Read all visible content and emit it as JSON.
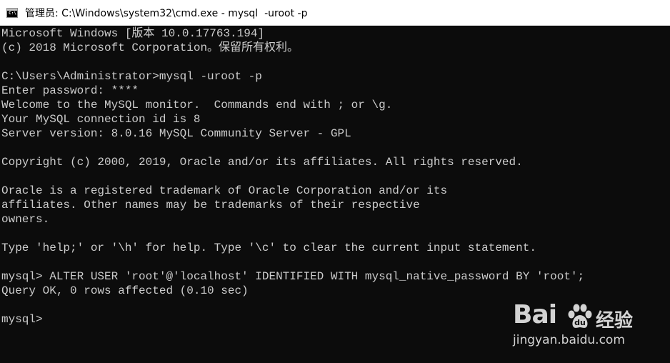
{
  "window": {
    "title": "管理员: C:\\Windows\\system32\\cmd.exe - mysql  -uroot -p",
    "icon": "cmd-icon"
  },
  "console": {
    "lines": [
      "Microsoft Windows [版本 10.0.17763.194]",
      "(c) 2018 Microsoft Corporation。保留所有权利。",
      "",
      "C:\\Users\\Administrator>mysql -uroot -p",
      "Enter password: ****",
      "Welcome to the MySQL monitor.  Commands end with ; or \\g.",
      "Your MySQL connection id is 8",
      "Server version: 8.0.16 MySQL Community Server - GPL",
      "",
      "Copyright (c) 2000, 2019, Oracle and/or its affiliates. All rights reserved.",
      "",
      "Oracle is a registered trademark of Oracle Corporation and/or its",
      "affiliates. Other names may be trademarks of their respective",
      "owners.",
      "",
      "Type 'help;' or '\\h' for help. Type '\\c' to clear the current input statement.",
      "",
      "mysql> ALTER USER 'root'@'localhost' IDENTIFIED WITH mysql_native_password BY 'root';",
      "Query OK, 0 rows affected (0.10 sec)",
      "",
      "mysql>"
    ]
  },
  "watermark": {
    "brand_left": "Bai",
    "brand_right": "经验",
    "url": "jingyan.baidu.com",
    "icon": "baidu-paw-icon"
  }
}
